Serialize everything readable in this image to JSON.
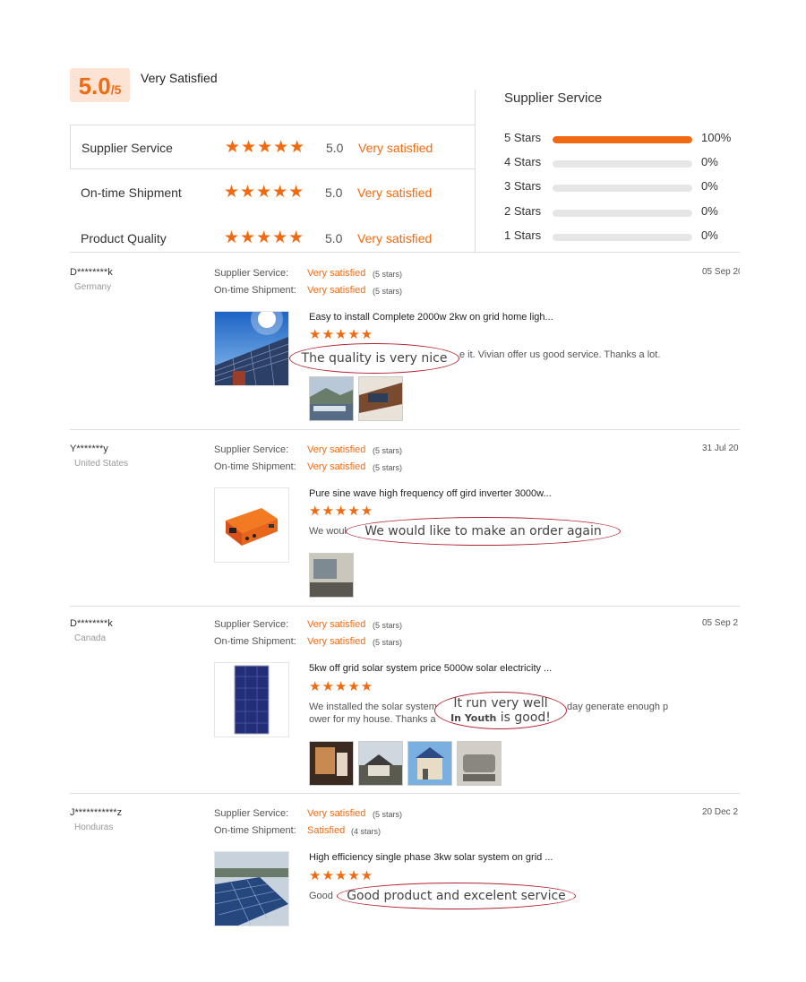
{
  "summary": {
    "score": "5.0",
    "score_denominator": "/5",
    "label": "Very Satisfied",
    "star_glyphs": "★★★★★",
    "rows": [
      {
        "label": "Supplier Service",
        "score": "5.0",
        "text": "Very satisfied"
      },
      {
        "label": "On-time Shipment",
        "score": "5.0",
        "text": "Very satisfied"
      },
      {
        "label": "Product Quality",
        "score": "5.0",
        "text": "Very satisfied"
      }
    ]
  },
  "distribution": {
    "title": "Supplier Service",
    "rows": [
      {
        "label": "5  Stars",
        "percent": "100%",
        "fill": 1.0
      },
      {
        "label": "4  Stars",
        "percent": "0%",
        "fill": 0
      },
      {
        "label": "3  Stars",
        "percent": "0%",
        "fill": 0
      },
      {
        "label": "2  Stars",
        "percent": "0%",
        "fill": 0
      },
      {
        "label": "1  Stars",
        "percent": "0%",
        "fill": 0
      }
    ]
  },
  "review_labels": {
    "supplier_service": "Supplier Service:",
    "ontime_shipment": "On-time Shipment:"
  },
  "reviews": [
    {
      "name": "D********k",
      "country": "Germany",
      "date": "05 Sep 20",
      "supplier_value": "Very satisfied",
      "supplier_stars": "(5 stars)",
      "shipment_value": "Very satisfied",
      "shipment_stars": "(5 stars)",
      "product_title": "Easy to install Complete 2000w 2kw on grid home ligh...",
      "text_visible": "e it. Vivian offer us good service. Thanks a lot.",
      "callout": "The quality is very nice"
    },
    {
      "name": "Y*******y",
      "country": "United States",
      "date": "31 Jul 20",
      "supplier_value": "Very satisfied",
      "supplier_stars": "(5 stars)",
      "shipment_value": "Very satisfied",
      "shipment_stars": "(5 stars)",
      "product_title": "Pure sine wave high frequency off gird inverter 3000w...",
      "text_visible": "We woul",
      "callout": "We would like to make an order again"
    },
    {
      "name": "D********k",
      "country": "Canada",
      "date": "05 Sep 2",
      "supplier_value": "Very satisfied",
      "supplier_stars": "(5 stars)",
      "shipment_value": "Very satisfied",
      "shipment_stars": "(5 stars)",
      "product_title": "5kw off grid solar system price 5000w solar electricity ...",
      "text_line1_a": "We installed the solar system",
      "text_line1_b": "day generate enough p",
      "text_line2": "ower for my house. Thanks a",
      "callout_line1": "It run very well",
      "callout_line2_bold": "In Youth",
      "callout_line2_rest": " is good!"
    },
    {
      "name": "J***********z",
      "country": "Honduras",
      "date": "20 Dec 2",
      "supplier_value": "Very satisfied",
      "supplier_stars": "(5 stars)",
      "shipment_value": "Satisfied",
      "shipment_stars": "(4 stars)",
      "product_title": "High efficiency single phase 3kw solar system on grid ...",
      "text_visible": "Good",
      "callout": "Good product and excelent service"
    }
  ],
  "colors": {
    "accent": "#f26a10",
    "callout_border": "#b22230",
    "track": "#e6e6e6"
  }
}
